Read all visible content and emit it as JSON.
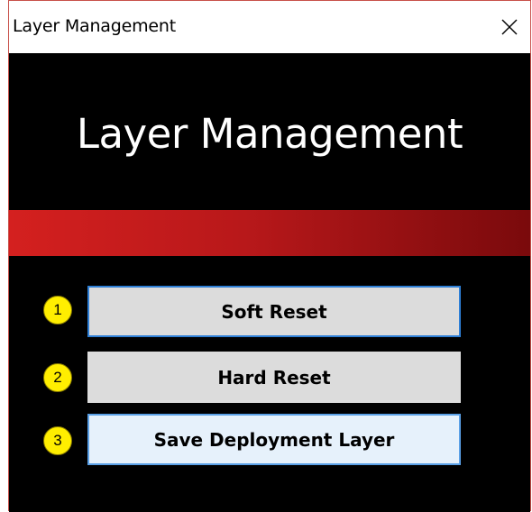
{
  "window": {
    "title": "Layer Management"
  },
  "header": {
    "title": "Layer Management"
  },
  "buttons": [
    {
      "number": "1",
      "label": "Soft Reset"
    },
    {
      "number": "2",
      "label": "Hard Reset"
    },
    {
      "number": "3",
      "label": "Save Deployment Layer"
    }
  ],
  "icons": {
    "close": "close-icon"
  },
  "colors": {
    "background": "#000000",
    "band_start": "#d4201f",
    "band_end": "#7a0a0c",
    "badge": "#ffee00",
    "button": "#dcdcdc",
    "focus_border": "#2e7fd6"
  }
}
